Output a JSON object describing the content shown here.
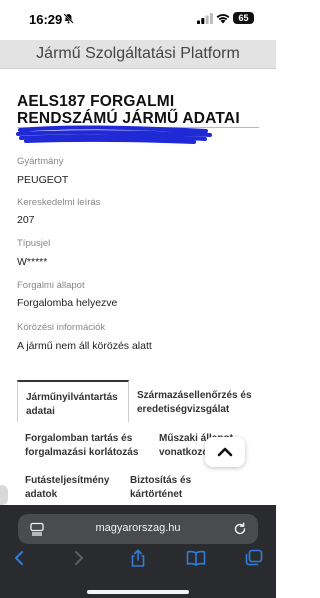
{
  "status_bar": {
    "time": "16:29",
    "battery": "65"
  },
  "header": {
    "title": "Jármű Szolgáltatási Platform"
  },
  "page": {
    "title": "AELS187 FORGALMI RENDSZÁMÚ JÁRMŰ ADATAI"
  },
  "fields": [
    {
      "label": "Gyártmány",
      "value": "PEUGEOT"
    },
    {
      "label": "Kereskedelmi leírás",
      "value": "207"
    },
    {
      "label": "Típusjel",
      "value": "W*****"
    },
    {
      "label": "Forgalmi állapot",
      "value": "Forgalomba helyezve"
    },
    {
      "label": "Körözési információk",
      "value": "A jármű nem áll körözés alatt"
    }
  ],
  "tabs": [
    {
      "label": "Járműnyilvántartás adatai",
      "active": true
    },
    {
      "label": "Származásellenőrzés és eredetiségvizsgálat",
      "active": false
    },
    {
      "label": "Forgalomban tartás és forgalmazási korlátozás",
      "active": false
    },
    {
      "label": "Műszaki állapot vonatkozó",
      "active": false
    },
    {
      "label": "Futásteljesítmény adatok",
      "active": false
    },
    {
      "label": "Biztosítás és kártörténet",
      "active": false
    }
  ],
  "browser": {
    "url": "magyarorszag.hu"
  },
  "icons": {
    "bell": "bell-slash-icon",
    "signal": "signal-icon",
    "wifi": "wifi-icon",
    "reader": "reader-icon",
    "reload": "reload-icon",
    "back": "back-arrow-icon",
    "forward": "forward-arrow-icon",
    "share": "share-icon",
    "bookmarks": "bookmarks-icon",
    "tabs": "tabs-icon",
    "scroll_top": "chevron-up-icon"
  },
  "colors": {
    "accent": "#2f7de1",
    "toolbar": "#2a2b2e",
    "scribble": "#1f2ad6"
  }
}
